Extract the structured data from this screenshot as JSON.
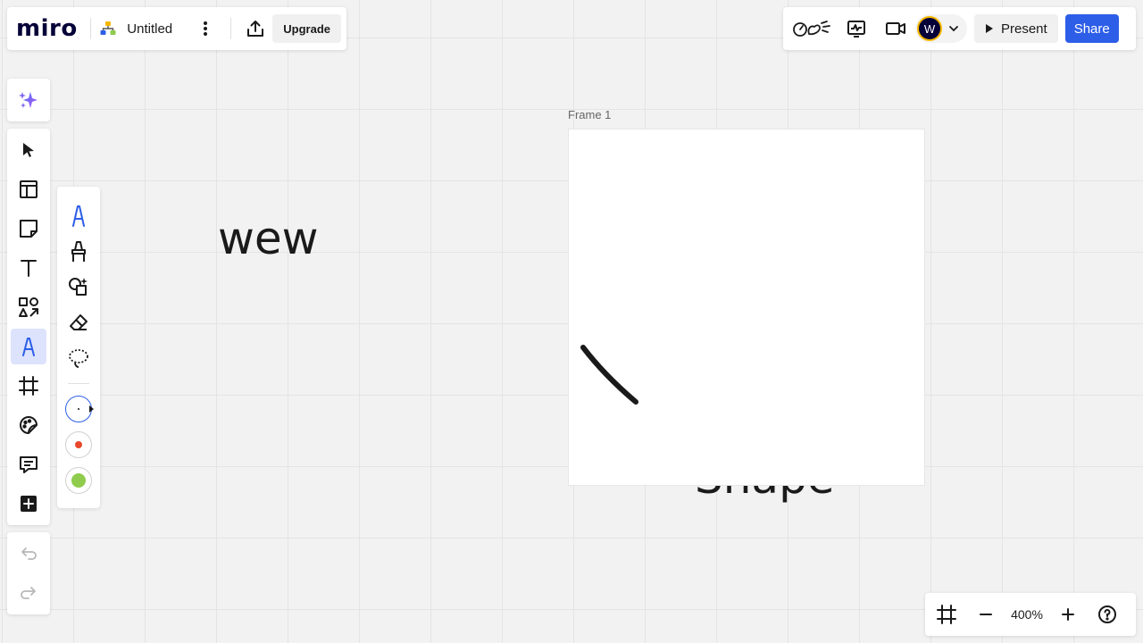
{
  "app": {
    "logo_text": "miro",
    "board_title": "Untitled"
  },
  "toolbar_top_left": {
    "board_icon": "board-tree-icon",
    "more_icon": "more-vertical-icon",
    "export_icon": "export-icon",
    "upgrade_label": "Upgrade"
  },
  "toolbar_top_right": {
    "reactions_icon": "reactions-icon",
    "activity_icon": "activity-chart-icon",
    "video_icon": "video-camera-icon",
    "avatar_initial": "W",
    "avatar_border_color": "#f5b800",
    "present_label": "Present",
    "share_label": "Share",
    "share_color": "#2d5ee8"
  },
  "main_toolbar": {
    "items": [
      {
        "name": "select",
        "icon": "cursor-icon",
        "active": false
      },
      {
        "name": "templates",
        "icon": "templates-icon",
        "active": false
      },
      {
        "name": "sticky-note",
        "icon": "sticky-note-icon",
        "active": false
      },
      {
        "name": "text",
        "icon": "text-icon",
        "active": false
      },
      {
        "name": "shapes",
        "icon": "shapes-icon",
        "active": false
      },
      {
        "name": "pen",
        "icon": "pen-icon",
        "active": true
      },
      {
        "name": "frame",
        "icon": "frame-icon",
        "active": false
      },
      {
        "name": "stickers",
        "icon": "sticker-icon",
        "active": false
      },
      {
        "name": "comment",
        "icon": "comment-icon",
        "active": false
      },
      {
        "name": "more-apps",
        "icon": "plus-square-icon",
        "active": false
      }
    ]
  },
  "pen_toolbar": {
    "tools": [
      "pen-icon",
      "highlighter-icon",
      "smart-draw-icon",
      "eraser-icon",
      "lasso-icon"
    ],
    "colors": [
      {
        "color": "#1a1a1a",
        "selected": true
      },
      {
        "color": "#e8472a",
        "selected": false
      },
      {
        "color": "#8fcb4c",
        "selected": false
      }
    ]
  },
  "canvas": {
    "texts": [
      "wew",
      "Shape"
    ],
    "frame_label": "Frame 1",
    "stroke_color": "#1a1a1a"
  },
  "zoom": {
    "value": "400%"
  }
}
